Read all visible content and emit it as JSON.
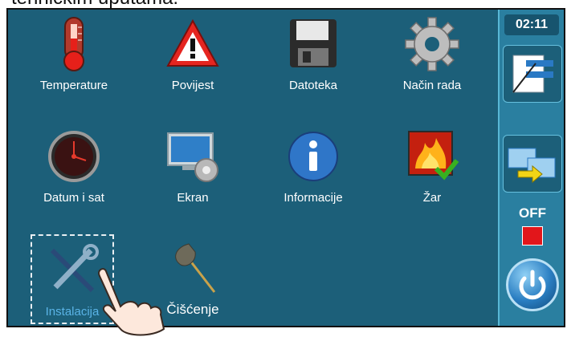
{
  "caption": "tehničkim uputama.",
  "tiles": [
    {
      "label": "Temperature",
      "icon": "thermometer-icon"
    },
    {
      "label": "Povijest",
      "icon": "warning-icon"
    },
    {
      "label": "Datoteka",
      "icon": "floppy-disk-icon"
    },
    {
      "label": "Način rada",
      "icon": "gear-icon"
    },
    {
      "label": "Datum i sat",
      "icon": "clock-icon"
    },
    {
      "label": "Ekran",
      "icon": "display-icon"
    },
    {
      "label": "Informacije",
      "icon": "info-icon"
    },
    {
      "label": "Žar",
      "icon": "fire-check-icon"
    },
    {
      "label": "Instalacija",
      "icon": "tools-icon",
      "selected": true
    },
    {
      "label": "Čišćenje",
      "icon": "duster-icon"
    }
  ],
  "sidebar": {
    "time": "02:11",
    "status": "OFF",
    "buttons": [
      "notes-icon",
      "arrows-icon"
    ],
    "power_icon": "power-icon",
    "status_color": "#e2161b"
  },
  "colors": {
    "screen_bg": "#1c5f79",
    "sidebar_bg": "#2a7fa0",
    "selected_label": "#5ab3e6"
  }
}
